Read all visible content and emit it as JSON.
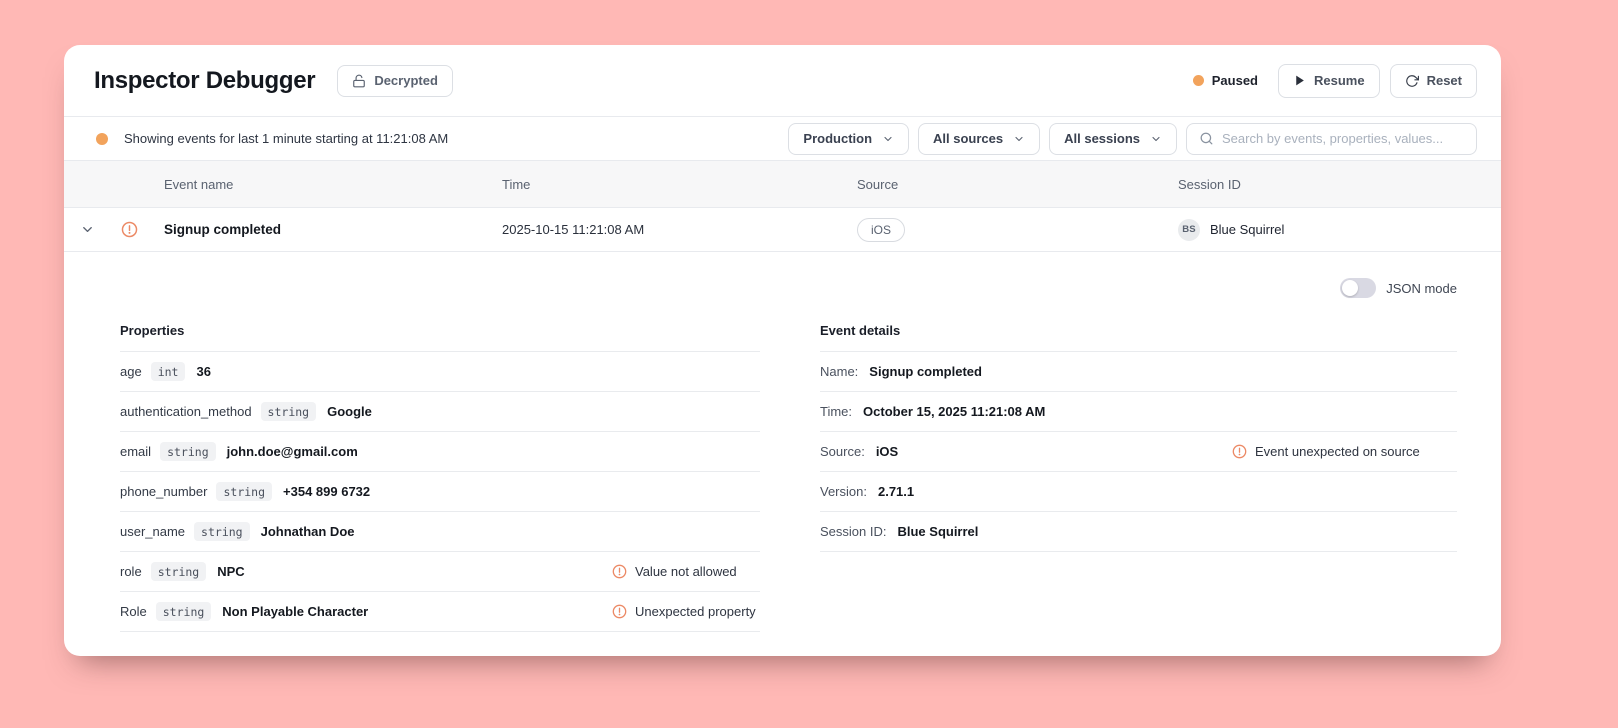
{
  "header": {
    "title": "Inspector Debugger",
    "decrypted_label": "Decrypted",
    "status_label": "Paused",
    "resume_label": "Resume",
    "reset_label": "Reset"
  },
  "filter_bar": {
    "status_text": "Showing events for last 1 minute starting at 11:21:08 AM",
    "environment_label": "Production",
    "sources_label": "All sources",
    "sessions_label": "All sessions",
    "search_placeholder": "Search by events, properties, values..."
  },
  "table": {
    "columns": [
      "Event name",
      "Time",
      "Source",
      "Session ID"
    ],
    "row": {
      "event_name": "Signup completed",
      "time": "2025-10-15 11:21:08 AM",
      "source": "iOS",
      "session_initials": "BS",
      "session_name": "Blue Squirrel"
    }
  },
  "detail": {
    "json_mode_label": "JSON mode",
    "json_mode_on": false,
    "properties": {
      "title": "Properties",
      "rows": [
        {
          "key": "age",
          "type": "int",
          "value": "36"
        },
        {
          "key": "authentication_method",
          "type": "string",
          "value": "Google"
        },
        {
          "key": "email",
          "type": "string",
          "value": "john.doe@gmail.com"
        },
        {
          "key": "phone_number",
          "type": "string",
          "value": "+354 899 6732"
        },
        {
          "key": "user_name",
          "type": "string",
          "value": "Johnathan Doe"
        },
        {
          "key": "role",
          "type": "string",
          "value": "NPC",
          "warning": "Value not allowed"
        },
        {
          "key": "Role",
          "type": "string",
          "value": "Non Playable Character",
          "warning": "Unexpected property"
        }
      ]
    },
    "event_details": {
      "title": "Event details",
      "rows": [
        {
          "label": "Name:",
          "value": "Signup completed"
        },
        {
          "label": "Time:",
          "value": "October 15, 2025 11:21:08 AM"
        },
        {
          "label": "Source:",
          "value": "iOS",
          "warning": "Event unexpected on source"
        },
        {
          "label": "Version:",
          "value": "2.71.1"
        },
        {
          "label": "Session ID:",
          "value": "Blue Squirrel"
        }
      ]
    }
  },
  "icons": {
    "decrypted": "unlock-icon",
    "resume": "play-icon",
    "reset": "rotate-cw-icon",
    "dropdowns": "chevron-down-icon",
    "search": "search-icon",
    "expander": "chevron-down-icon",
    "warnings": "alert-circle-icon"
  },
  "colors": {
    "page_background": "#ffb8b5",
    "card_background": "#ffffff",
    "status_orange": "#f2a35c",
    "warning_orange": "#ec8a66",
    "divider": "#e8eaee"
  }
}
